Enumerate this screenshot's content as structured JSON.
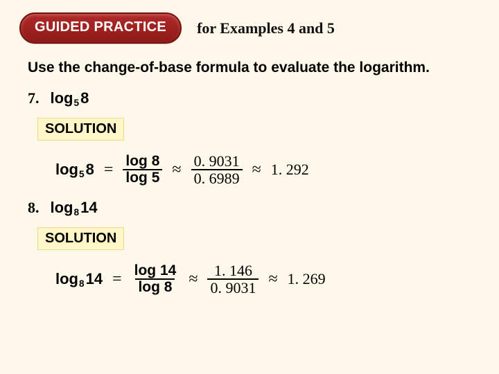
{
  "header": {
    "pill_label": "GUIDED PRACTICE",
    "subtitle": "for Examples 4 and 5"
  },
  "instruction": "Use the change-of-base formula to evaluate the logarithm.",
  "solution_label": "SOLUTION",
  "symbols": {
    "eq": "=",
    "approx": "≈"
  },
  "problems": [
    {
      "number": "7.",
      "log_word": "log",
      "base": "5",
      "arg": "8",
      "frac_log": {
        "num_word": "log",
        "num_arg": "8",
        "den_word": "log",
        "den_arg": "5"
      },
      "frac_num": {
        "num": "0. 9031",
        "den": "0. 6989"
      },
      "result": "1. 292"
    },
    {
      "number": "8.",
      "log_word": "log",
      "base": "8",
      "arg": "14",
      "frac_log": {
        "num_word": "log",
        "num_arg": "14",
        "den_word": "log",
        "den_arg": "8"
      },
      "frac_num": {
        "num": "1. 146",
        "den": "0. 9031"
      },
      "result": "1. 269"
    }
  ]
}
